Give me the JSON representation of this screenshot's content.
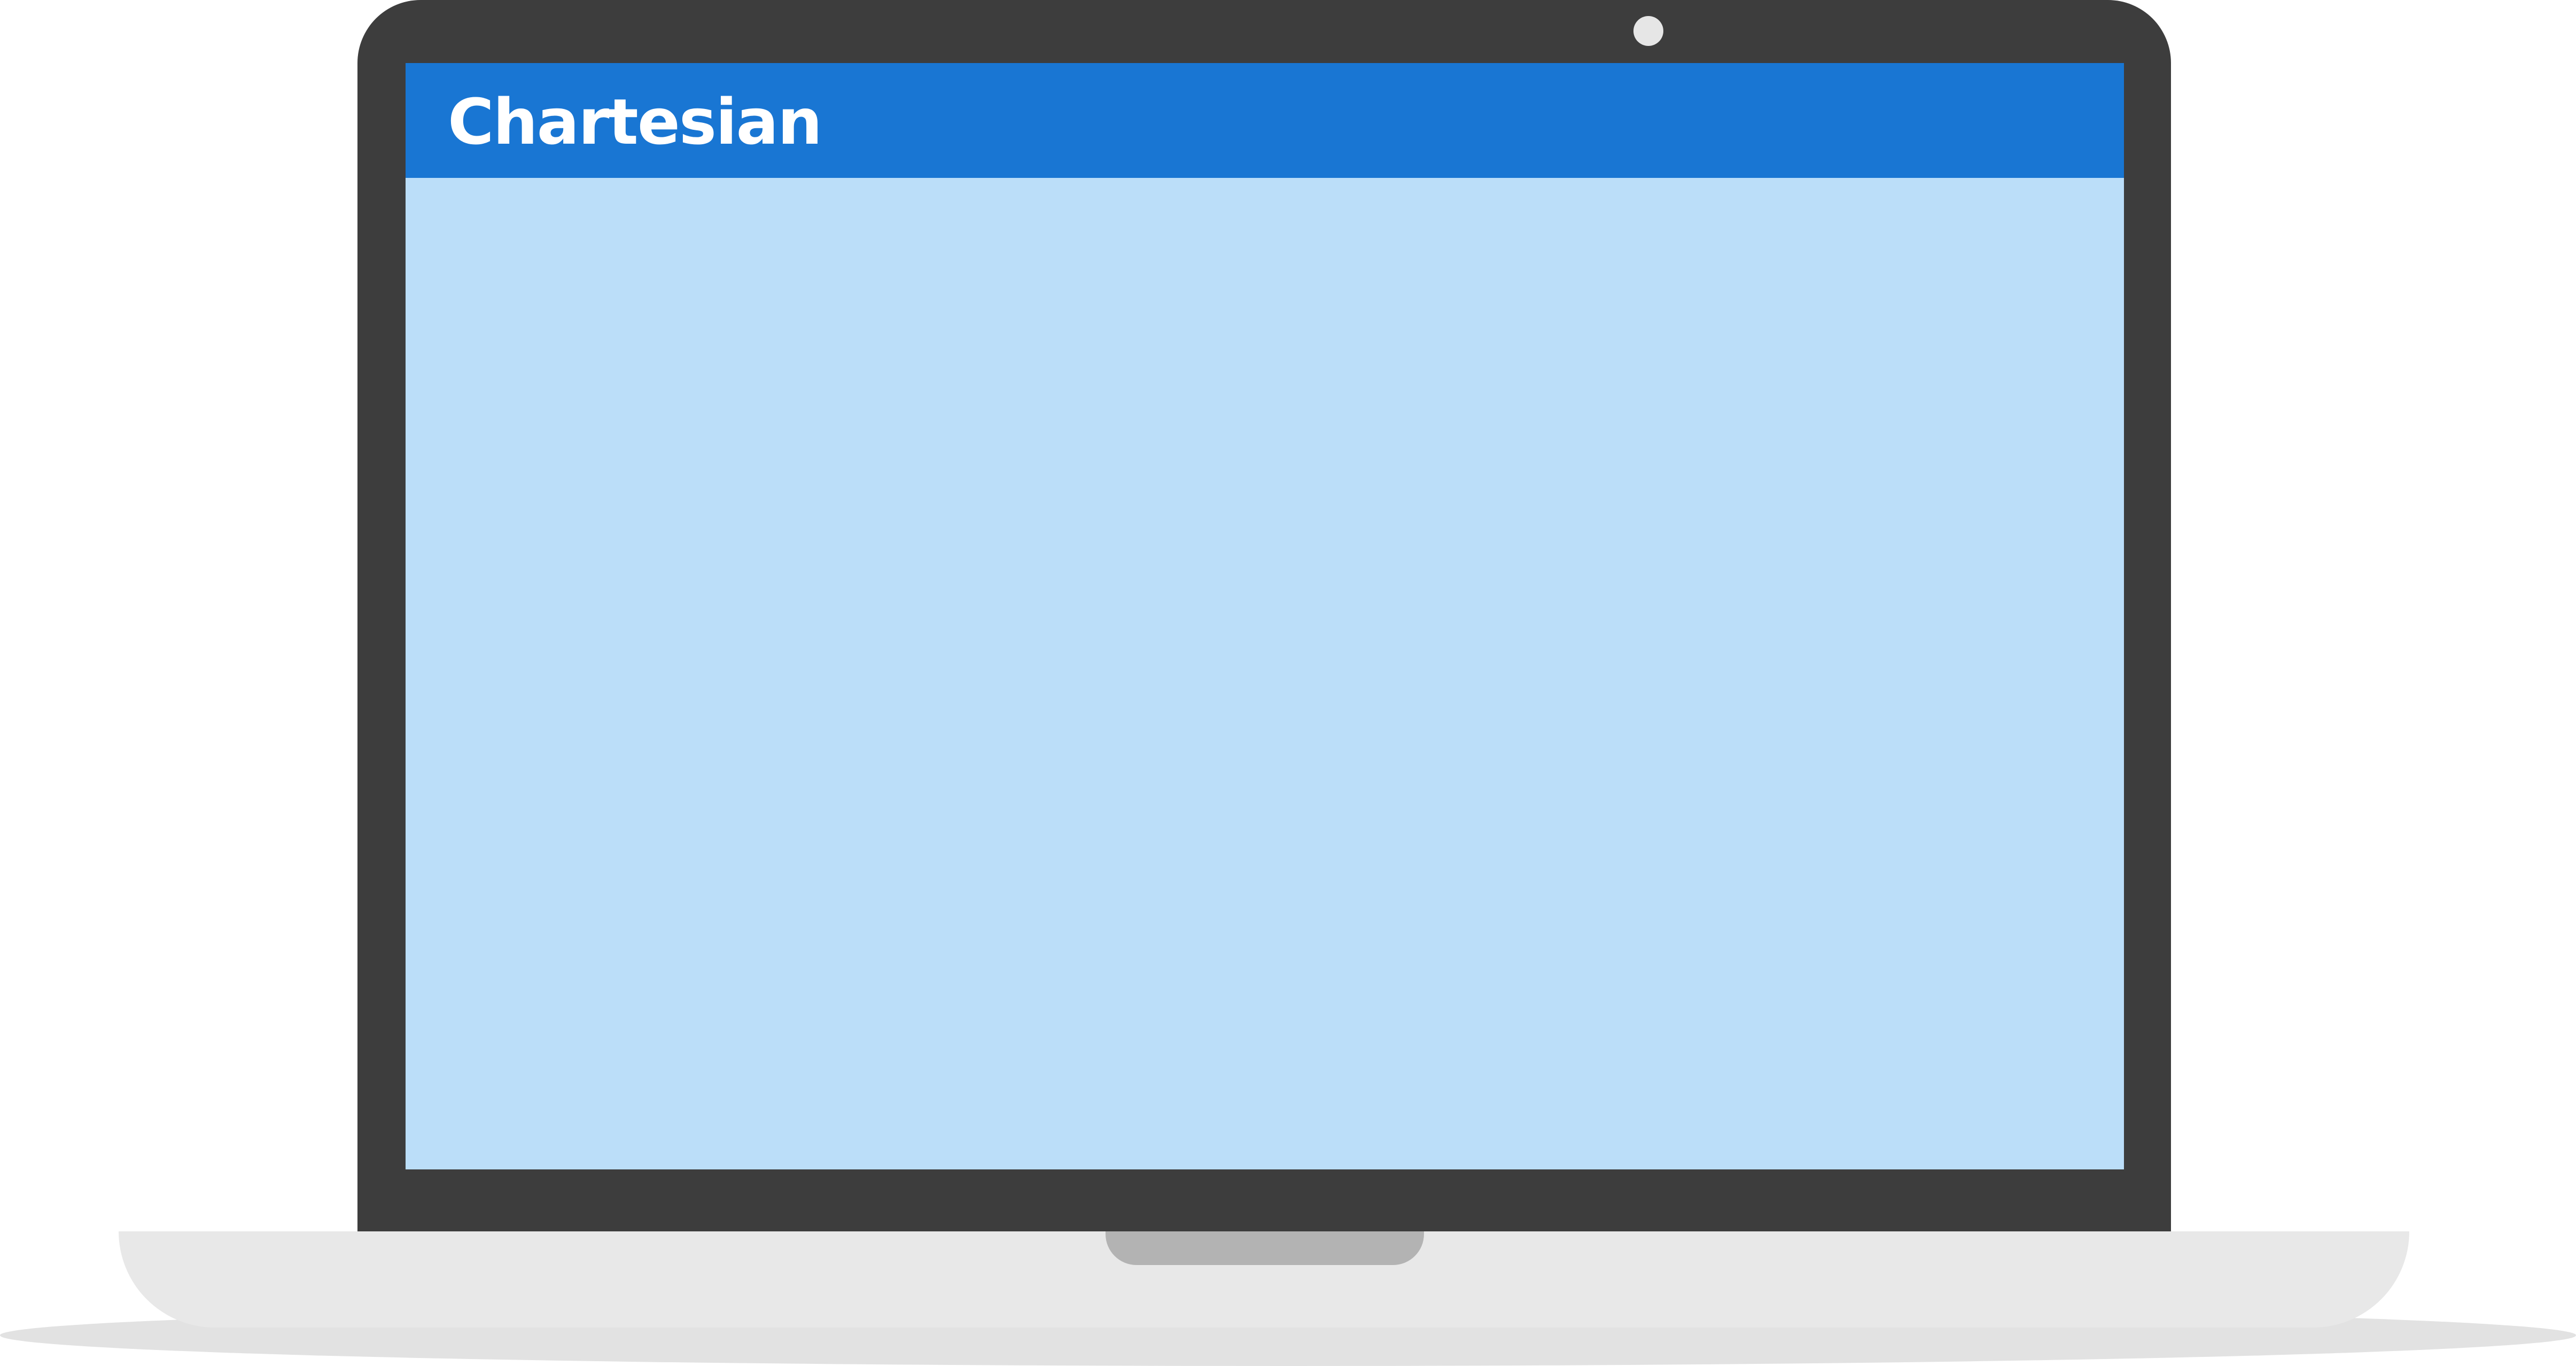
{
  "app": {
    "title": "Chartesian"
  },
  "colors": {
    "app_bar": "#1976d3",
    "content_background": "#bbdef9",
    "device_bezel": "#3d3d3d",
    "device_base": "#e8e8e8",
    "device_notch": "#b3b3b3",
    "floor_shadow": "#e2e2e2",
    "webcam": "#e6e6e6"
  },
  "icons": {
    "webcam": "webcam-icon"
  }
}
